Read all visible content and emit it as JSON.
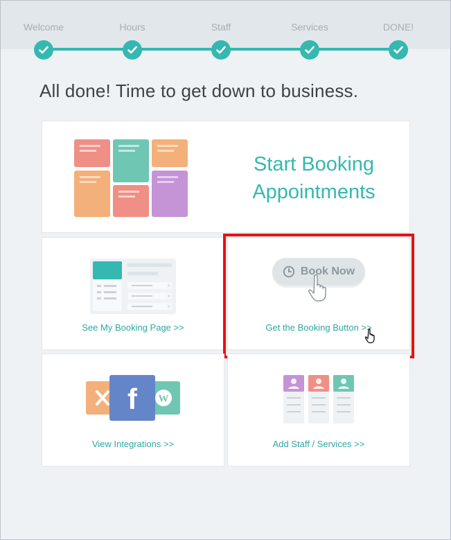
{
  "wizard": {
    "steps": [
      {
        "label": "Welcome"
      },
      {
        "label": "Hours"
      },
      {
        "label": "Staff"
      },
      {
        "label": "Services"
      },
      {
        "label": "DONE!"
      }
    ],
    "step_icon": "check-icon",
    "accent_color": "#35b8b0"
  },
  "headline": "All done! Time to get down to business.",
  "hero": {
    "title": "Start Booking Appointments",
    "icon": "calendar-grid-illustration"
  },
  "cards": {
    "booking_page": {
      "link": "See My Booking Page >>",
      "icon": "booking-page-illustration"
    },
    "booking_button": {
      "button_label": "Book Now",
      "link": "Get the Booking Button >>",
      "icon": "clock-icon"
    },
    "integrations": {
      "link": "View Integrations >>",
      "icons": [
        "joomla-icon",
        "facebook-icon",
        "wordpress-icon"
      ]
    },
    "staff_services": {
      "link": "Add Staff / Services >>",
      "icon": "staff-columns-illustration"
    }
  },
  "highlight_color": "#ef0e0e"
}
